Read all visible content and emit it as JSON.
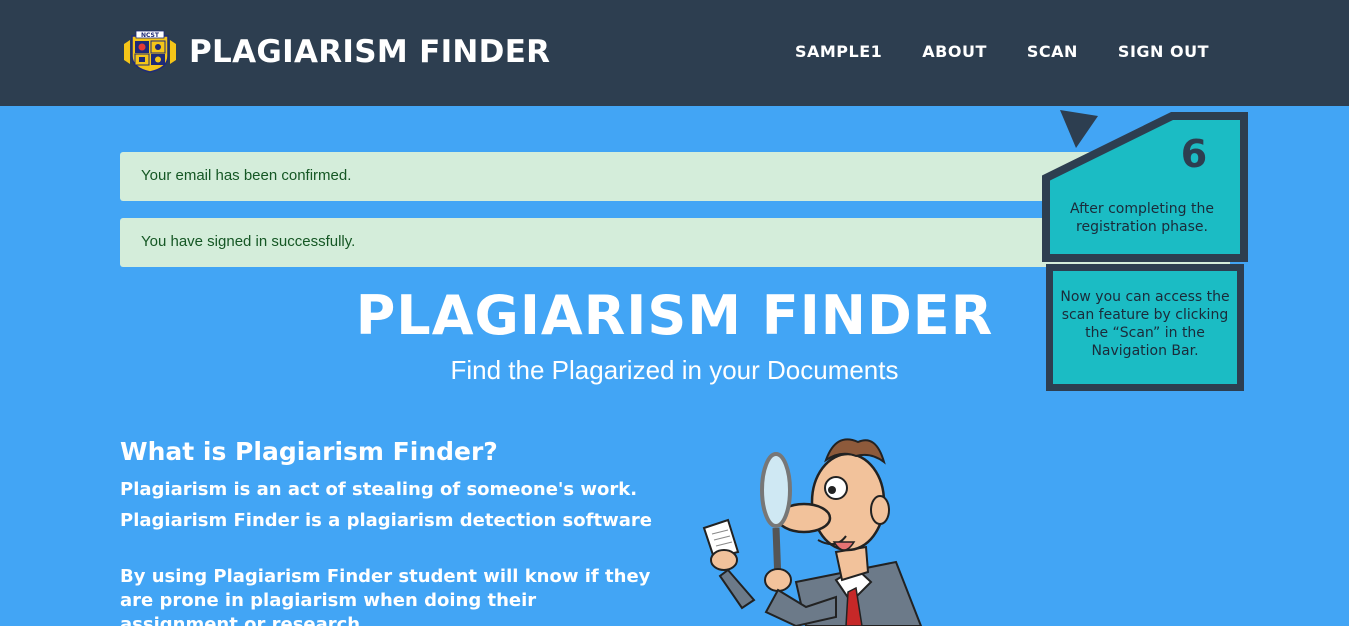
{
  "navbar": {
    "brand": "PLAGIARISM FINDER",
    "logo_text": "NCST",
    "links": [
      "SAMPLE1",
      "ABOUT",
      "SCAN",
      "SIGN OUT"
    ]
  },
  "alerts": [
    "Your email has been confirmed.",
    "You have signed in successfully."
  ],
  "hero": {
    "title": "PLAGIARISM FINDER",
    "subtitle": "Find the Plagarized in your Documents"
  },
  "about": {
    "title": "What is Plagiarism Finder?",
    "paragraphs": [
      "Plagiarism is an act of stealing of someone's work.",
      "Plagiarism Finder is a plagiarism detection software",
      "By using Plagiarism Finder student will know if they are prone in plagiarism when doing their assignment or research"
    ]
  },
  "tutorial": {
    "step_number": "6",
    "step_text": "After completing the registration phase.",
    "hint_text": "Now you can access the scan feature by clicking the “Scan” in the Navigation Bar."
  },
  "colors": {
    "navbar_bg": "#2d3e50",
    "page_bg": "#42a5f5",
    "alert_bg": "#d4edda",
    "alert_text": "#155724",
    "callout_fill": "#1bbcc4"
  }
}
